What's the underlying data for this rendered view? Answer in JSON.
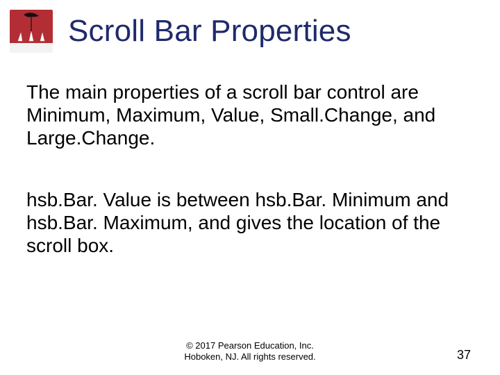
{
  "title": "Scroll Bar Properties",
  "body": {
    "p1": "The main properties of a scroll bar control are Minimum, Maximum, Value, Small.Change, and Large.Change.",
    "p2": "hsb.Bar. Value is between hsb.Bar. Minimum and hsb.Bar. Maximum, and gives the location of the scroll box."
  },
  "footer": {
    "line1": "© 2017 Pearson Education, Inc.",
    "line2": "Hoboken, NJ. All rights reserved."
  },
  "page_number": "37",
  "logo": {
    "name": "publisher-logo",
    "colors": {
      "bg": "#b32d34",
      "umbrella": "#111111",
      "ground": "#f3f3f3"
    }
  }
}
